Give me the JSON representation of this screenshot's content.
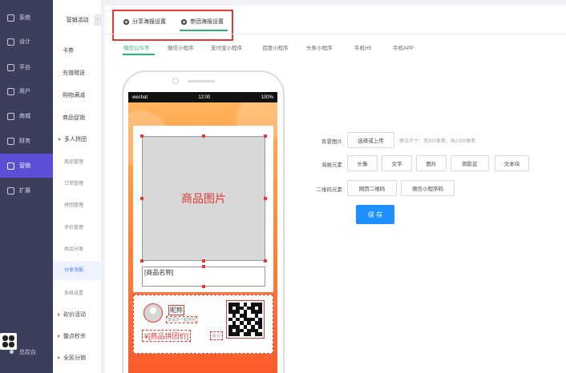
{
  "nav": {
    "items": [
      {
        "label": "系统",
        "icon": "settings-icon"
      },
      {
        "label": "设计",
        "icon": "design-icon"
      },
      {
        "label": "平台",
        "icon": "platform-icon"
      },
      {
        "label": "用户",
        "icon": "user-icon"
      },
      {
        "label": "商城",
        "icon": "shop-icon"
      },
      {
        "label": "财务",
        "icon": "finance-icon"
      },
      {
        "label": "营销",
        "icon": "marketing-icon"
      },
      {
        "label": "扩展",
        "icon": "extension-icon"
      }
    ],
    "active_index": 6,
    "footer_label": "总控台"
  },
  "menu": {
    "title": "营销活动",
    "collapse": "‹",
    "items": [
      {
        "label": "卡券",
        "type": "item"
      },
      {
        "label": "充值赠送",
        "type": "item"
      },
      {
        "label": "购物满减",
        "type": "item"
      },
      {
        "label": "商品促销",
        "type": "item"
      },
      {
        "label": "多人拼团",
        "type": "group-open"
      },
      {
        "label": "商品管理",
        "type": "sub"
      },
      {
        "label": "订单管理",
        "type": "sub"
      },
      {
        "label": "拼团管理",
        "type": "sub"
      },
      {
        "label": "评价管理",
        "type": "sub"
      },
      {
        "label": "商品分类",
        "type": "sub"
      },
      {
        "label": "分享海报",
        "type": "sub-active"
      },
      {
        "label": "系统设置",
        "type": "sub"
      },
      {
        "label": "砍价活动",
        "type": "group"
      },
      {
        "label": "整点秒杀",
        "type": "group"
      },
      {
        "label": "全民分销",
        "type": "group"
      }
    ]
  },
  "top_tabs": {
    "share_poster": "分享海报设置",
    "group_poster": "参团海报设置"
  },
  "platform_tabs": [
    "微信公众号",
    "微信小程序",
    "支付宝小程序",
    "百度小程序",
    "头条小程序",
    "手机H5",
    "手机APP"
  ],
  "phone": {
    "carrier": "wechat",
    "time": "12:00",
    "battery": "100%",
    "goods_image": "商品图片",
    "goods_name": "[商品名称]",
    "nickname": "昵称",
    "invite": "邀请您一起拼团",
    "price": "¥[商品拼团价]",
    "original_price": "原价"
  },
  "form": {
    "background_label": "背景图片",
    "background_button": "选择或上传",
    "background_hint": "建议尺寸：宽680像素，高1300像素",
    "elements_label": "海报元素",
    "elements": [
      "头像",
      "文字",
      "图片",
      "阴影区",
      "文本块"
    ],
    "qr_label": "二维码元素",
    "qr_buttons": [
      "网页二维码",
      "微信小程序码"
    ],
    "save": "保 存"
  }
}
